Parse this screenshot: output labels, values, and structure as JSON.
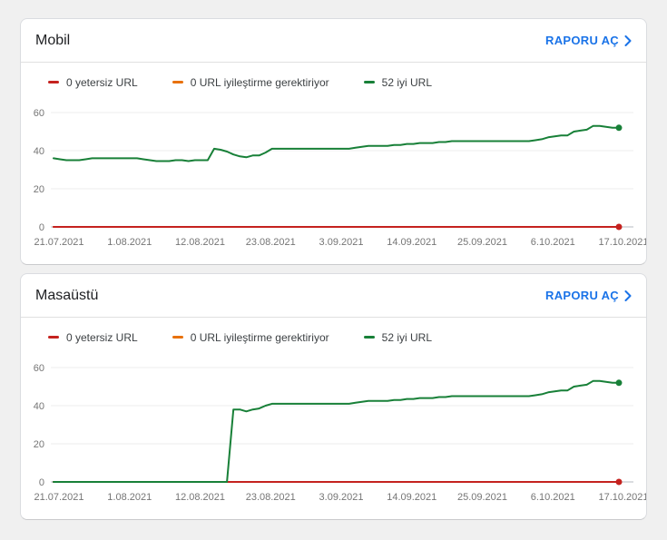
{
  "page": {
    "background": "#f0f0f0"
  },
  "colors": {
    "poor": "#c5221f",
    "needs_improvement": "#e8710a",
    "good": "#188038",
    "link": "#1a73e8",
    "gridline": "#ececec",
    "baseline": "#dadce0",
    "axis_text": "#757575"
  },
  "cards": [
    {
      "title": "Mobil",
      "report_link": "RAPORU AÇ",
      "legend": [
        {
          "label": "0 yetersiz URL",
          "color": "#c5221f"
        },
        {
          "label": "0 URL iyileştirme gerektiriyor",
          "color": "#e8710a"
        },
        {
          "label": "52 iyi URL",
          "color": "#188038"
        }
      ]
    },
    {
      "title": "Masaüstü",
      "report_link": "RAPORU AÇ",
      "legend": [
        {
          "label": "0 yetersiz URL",
          "color": "#c5221f"
        },
        {
          "label": "0 URL iyileştirme gerektiriyor",
          "color": "#e8710a"
        },
        {
          "label": "52 iyi URL",
          "color": "#188038"
        }
      ]
    }
  ],
  "chart_data": [
    {
      "type": "line",
      "title": "Mobil",
      "x_tick_labels": [
        "21.07.2021",
        "1.08.2021",
        "12.08.2021",
        "23.08.2021",
        "3.09.2021",
        "14.09.2021",
        "25.09.2021",
        "6.10.2021",
        "17.10.2021"
      ],
      "x_days_span": 88,
      "y_ticks": [
        0,
        20,
        40,
        60
      ],
      "ylim": [
        0,
        66
      ],
      "grid": true,
      "legend_position": "top",
      "series": [
        {
          "name": "0 URL iyileştirme gerektiriyor",
          "color": "#e8710a",
          "constant": 0,
          "dot": false
        },
        {
          "name": "0 yetersiz URL",
          "color": "#c5221f",
          "constant": 0,
          "dot": true
        },
        {
          "name": "52 iyi URL",
          "color": "#188038",
          "dot": true,
          "values": [
            36,
            35.5,
            35,
            35,
            35,
            35.5,
            36,
            36,
            36,
            36,
            36,
            36,
            36,
            36,
            35.5,
            35,
            34.5,
            34.5,
            34.5,
            35,
            35,
            34.5,
            35,
            35,
            35,
            41,
            40.5,
            39.5,
            38,
            37,
            36.5,
            37.5,
            37.5,
            39,
            41,
            41,
            41,
            41,
            41,
            41,
            41,
            41,
            41,
            41,
            41,
            41,
            41,
            41.5,
            42,
            42.5,
            42.5,
            42.5,
            42.5,
            43,
            43,
            43.5,
            43.5,
            44,
            44,
            44,
            44.5,
            44.5,
            45,
            45,
            45,
            45,
            45,
            45,
            45,
            45,
            45,
            45,
            45,
            45,
            45,
            45.5,
            46,
            47,
            47.5,
            48,
            48,
            50,
            50.5,
            51,
            53,
            53,
            52.5,
            52,
            52
          ]
        }
      ]
    },
    {
      "type": "line",
      "title": "Masaüstü",
      "x_tick_labels": [
        "21.07.2021",
        "1.08.2021",
        "12.08.2021",
        "23.08.2021",
        "3.09.2021",
        "14.09.2021",
        "25.09.2021",
        "6.10.2021",
        "17.10.2021"
      ],
      "x_days_span": 88,
      "y_ticks": [
        0,
        20,
        40,
        60
      ],
      "ylim": [
        0,
        66
      ],
      "grid": true,
      "legend_position": "top",
      "series": [
        {
          "name": "0 URL iyileştirme gerektiriyor",
          "color": "#e8710a",
          "constant": 0,
          "dot": false
        },
        {
          "name": "0 yetersiz URL",
          "color": "#c5221f",
          "constant": 0,
          "dot": true
        },
        {
          "name": "52 iyi URL",
          "color": "#188038",
          "dot": true,
          "values": [
            0,
            0,
            0,
            0,
            0,
            0,
            0,
            0,
            0,
            0,
            0,
            0,
            0,
            0,
            0,
            0,
            0,
            0,
            0,
            0,
            0,
            0,
            0,
            0,
            0,
            0,
            0,
            0,
            38,
            38,
            37,
            38,
            38.5,
            40,
            41,
            41,
            41,
            41,
            41,
            41,
            41,
            41,
            41,
            41,
            41,
            41,
            41,
            41.5,
            42,
            42.5,
            42.5,
            42.5,
            42.5,
            43,
            43,
            43.5,
            43.5,
            44,
            44,
            44,
            44.5,
            44.5,
            45,
            45,
            45,
            45,
            45,
            45,
            45,
            45,
            45,
            45,
            45,
            45,
            45,
            45.5,
            46,
            47,
            47.5,
            48,
            48,
            50,
            50.5,
            51,
            53,
            53,
            52.5,
            52,
            52
          ]
        }
      ]
    }
  ]
}
